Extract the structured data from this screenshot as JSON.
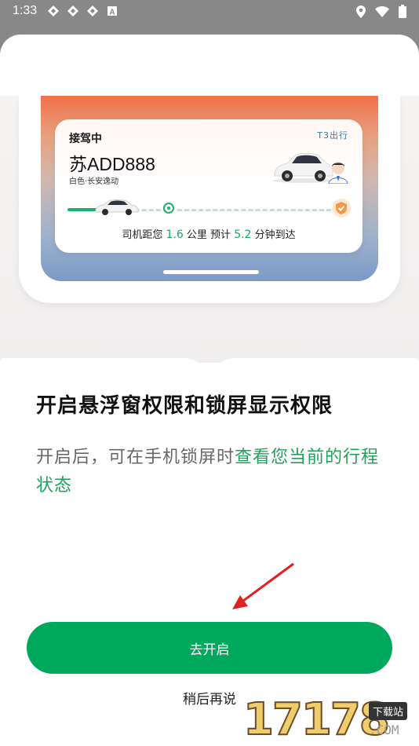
{
  "status_bar": {
    "time": "1:33",
    "left_icons": [
      "app-notification-icon",
      "app-notification-icon",
      "app-notification-icon",
      "a-badge-icon"
    ],
    "right_icons": [
      "location-icon",
      "wifi-icon",
      "battery-icon"
    ]
  },
  "trip_card": {
    "status": "接驾中",
    "plate": "苏ADD888",
    "car_info": "白色·长安逸动",
    "brand": "T3出行",
    "eta_prefix": "司机距您",
    "eta_distance": "1.6",
    "eta_distance_unit": "公里  预计",
    "eta_time": "5.2",
    "eta_suffix": "分钟到达"
  },
  "main": {
    "title": "开启悬浮窗权限和锁屏显示权限",
    "desc_plain": "开启后，可在手机锁屏时",
    "desc_highlight": "查看您当前的行程状态"
  },
  "actions": {
    "enable_label": "去开启",
    "later_label": "稍后再说"
  },
  "watermark": {
    "digits": "17178",
    "site": "下载站",
    "com": ".COM"
  },
  "colors": {
    "accent": "#00a85c",
    "highlight": "#1fa35a"
  }
}
